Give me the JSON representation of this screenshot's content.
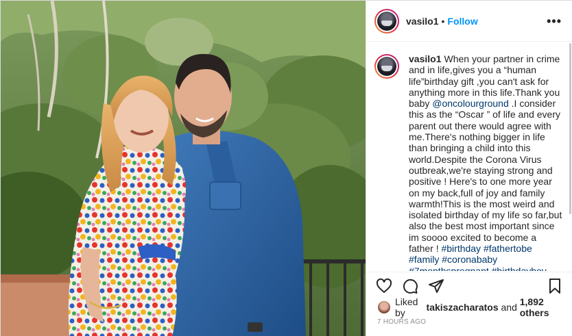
{
  "post": {
    "username": "vasilo1",
    "separator": "•",
    "follow_label": "Follow",
    "more_icon": "more-horizontal-icon",
    "more_label": "•••",
    "photo_description": "couple-photo",
    "caption": {
      "username": "vasilo1",
      "text_part1": "When your partner in crime and in life,gives you a “human life”birthday gift ,you can't ask for anything more in this life.Thank you baby ",
      "mention": "@oncolourground",
      "text_part2": " .I consider this as the “Oscar ” of life and every parent out there would agree with me.There's nothing bigger in life than bringing a child into this world.Despite the Corona Virus outbreak,we're staying strong and positive ! Here's to one more year on my back,full of joy and family warmth!This is the most weird and isolated birthday of my life so far,but also the best most important since im soooo excited to become a father ! ",
      "hashtags": "#birthday #fathertobe #family #coronababy #7monthspregnant #birthdayboy #love #balance #dad"
    },
    "actions": {
      "like_icon": "heart-icon",
      "comment_icon": "comment-icon",
      "share_icon": "paper-plane-icon",
      "save_icon": "bookmark-icon"
    },
    "likes": {
      "prefix": "Liked by ",
      "liker": "takiszacharatos",
      "middle": " and ",
      "others": "1,892 others"
    },
    "timestamp": "7 HOURS AGO"
  }
}
